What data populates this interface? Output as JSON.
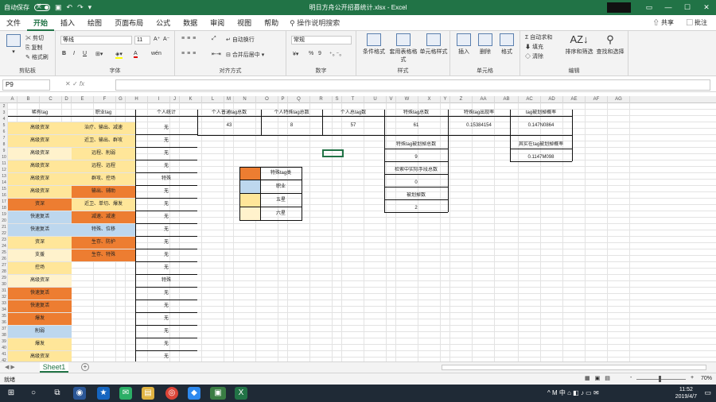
{
  "titlebar": {
    "autosave": "自动保存",
    "toggle": "关",
    "title": "明日方舟公开招募统计.xlsx - Excel",
    "undo": "↶",
    "redo": "↷",
    "win_min": "—",
    "win_max": "☐",
    "win_close": "✕"
  },
  "menu": {
    "tabs": [
      "文件",
      "开始",
      "插入",
      "绘图",
      "页面布局",
      "公式",
      "数据",
      "审阅",
      "视图",
      "帮助"
    ],
    "search": "操作说明搜索",
    "share": "共享",
    "comment": "批注"
  },
  "ribbon": {
    "clipboard": {
      "cut": "剪切",
      "copy": "复制",
      "format_painter": "格式刷",
      "label": "剪贴板"
    },
    "font": {
      "name": "等线",
      "size": "11",
      "label": "字体",
      "grow": "A⁺",
      "shrink": "A⁻",
      "bold": "B",
      "italic": "I",
      "underline": "U",
      "font_color": "A",
      "phonetic": "wén"
    },
    "align": {
      "wrap": "自动换行",
      "merge": "合并后居中",
      "label": "对齐方式"
    },
    "number": {
      "format": "常规",
      "label": "数字",
      "percent": "%",
      "comma": "9"
    },
    "styles": {
      "conditional": "条件格式",
      "table": "套用表格格式",
      "cell": "单元格样式",
      "label": "样式"
    },
    "cells": {
      "insert": "插入",
      "delete": "删除",
      "format": "格式",
      "label": "单元格"
    },
    "editing": {
      "autosum": "自动求和",
      "fill": "填充",
      "clear": "清除",
      "sort": "排序和筛选",
      "find": "查找和选择",
      "label": "编辑"
    }
  },
  "formula": {
    "namebox": "P9",
    "fx": "fx",
    "cancel": "✕",
    "confirm": "✓",
    "value": ""
  },
  "sheet": {
    "columns": [
      "A",
      "B",
      "C",
      "D",
      "E",
      "F",
      "G",
      "H",
      "I",
      "J",
      "K",
      "L",
      "M",
      "N",
      "O",
      "P",
      "Q",
      "R",
      "S",
      "T",
      "U",
      "V",
      "W",
      "X",
      "Y",
      "Z",
      "AA",
      "AB",
      "AC",
      "AD",
      "AE",
      "AF",
      "AG"
    ],
    "rows": [
      "2",
      "3",
      "4",
      "5",
      "6",
      "7",
      "8",
      "9",
      "10",
      "11",
      "12",
      "13",
      "14",
      "15",
      "16",
      "17",
      "18",
      "19",
      "20",
      "21",
      "22",
      "23",
      "24",
      "25",
      "26",
      "27",
      "28",
      "29",
      "30",
      "31",
      "32",
      "33",
      "34",
      "35",
      "36",
      "37",
      "38",
      "39",
      "40",
      "41",
      "42"
    ],
    "headers": {
      "b": "稀有tag",
      "e": "职业tag",
      "h": "个人统计",
      "k": "个人普通tag总数",
      "n": "个人特殊tag总数",
      "q": "个人总tag数",
      "t": "特殊tag总数",
      "w": "特殊tag出现率",
      "z": "tag被划掉概率"
    },
    "stats": {
      "k": "43",
      "n": "8",
      "q": "57",
      "t": "61",
      "w": "0.15384154",
      "z": "0.147N0864",
      "t_label2": "特殊tag被划掉总数",
      "t_val2": "9",
      "t_label3": "检索中实际手段总数",
      "t_val3": "0",
      "t_label4": "被划掉数",
      "t_val4": "2",
      "z_label2": "其实在tag被划掉概率",
      "z_val2": "0.1147M098"
    },
    "rarity": [
      "高级资深",
      "高级资深",
      "高级资深",
      "高级资深",
      "高级资深",
      "高级资深",
      "资深",
      "快速复活",
      "快速复活",
      "资深",
      "支援",
      "控场",
      "高级资深",
      "快速复活",
      "快速复活",
      "爆发",
      "削弱",
      "爆发",
      "高级资深",
      "高级资深"
    ],
    "roles": [
      "治疗、输出、减速",
      "近卫、输出、群攻",
      "远程、削弱",
      "远程、远程",
      "群攻、控场",
      "输出、辅助",
      "近卫、单切、爆发",
      "减速、减速",
      "特殊、位移",
      "生存、防护",
      "生存、特殊",
      "",
      "",
      "",
      "",
      "",
      "",
      "",
      "",
      ""
    ],
    "personal": [
      "无",
      "无",
      "无",
      "无",
      "特殊",
      "无",
      "无",
      "无",
      "无",
      "无",
      "无",
      "无",
      "特殊",
      "无",
      "无",
      "无",
      "无",
      "无",
      "无",
      "特殊"
    ],
    "legend": [
      {
        "label": "特殊tag类",
        "color": "#ed7d31"
      },
      {
        "label": "职业",
        "color": "#bdd7ee"
      },
      {
        "label": "五星",
        "color": "#ffe699"
      },
      {
        "label": "六星",
        "color": "#fff2cc"
      }
    ]
  },
  "colors": {
    "orange": "#ed7d31",
    "blue": "#bdd7ee",
    "yellow": "#ffe699",
    "lightyellow": "#fff2cc",
    "excel_green": "#217346"
  },
  "tabs": {
    "sheet": "Sheet1",
    "add": "+",
    "nav": "◀ ▶"
  },
  "status": {
    "ready": "就绪",
    "zoom": "70%",
    "zoom_minus": "-",
    "zoom_plus": "+"
  },
  "taskbar": {
    "time": "11:52",
    "date": "2019/4/7",
    "ime": "中",
    "ime_m": "M",
    "start": "⊞",
    "search": "○"
  }
}
